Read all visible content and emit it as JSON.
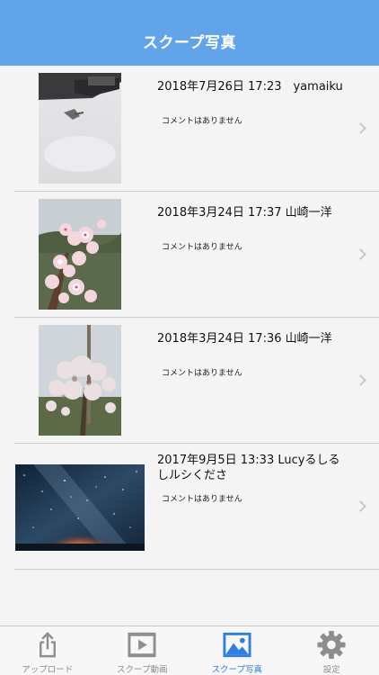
{
  "nav": {
    "title": "スクープ写真"
  },
  "list": {
    "items": [
      {
        "date": "2018年7月26日 17:23　yamaiku",
        "comment": "コメントはありません"
      },
      {
        "date": "2018年3月24日 17:37 山崎一洋",
        "comment": "コメントはありません"
      },
      {
        "date": "2018年3月24日 17:36 山崎一洋",
        "comment": "コメントはありません"
      },
      {
        "date": "2017年9月5日 13:33 Lucyるしるしルシくださ",
        "comment": "コメントはありません"
      }
    ]
  },
  "tabbar": {
    "tabs": [
      {
        "label": "アップロード",
        "icon": "upload-icon",
        "active": false
      },
      {
        "label": "スクープ動画",
        "icon": "video-icon",
        "active": false
      },
      {
        "label": "スクープ写真",
        "icon": "photo-icon",
        "active": true
      },
      {
        "label": "設定",
        "icon": "gear-icon",
        "active": false
      }
    ],
    "active_color": "#2e7fe0",
    "inactive_color": "#8e8e8e"
  },
  "colors": {
    "navbar": "#62a4ea"
  }
}
